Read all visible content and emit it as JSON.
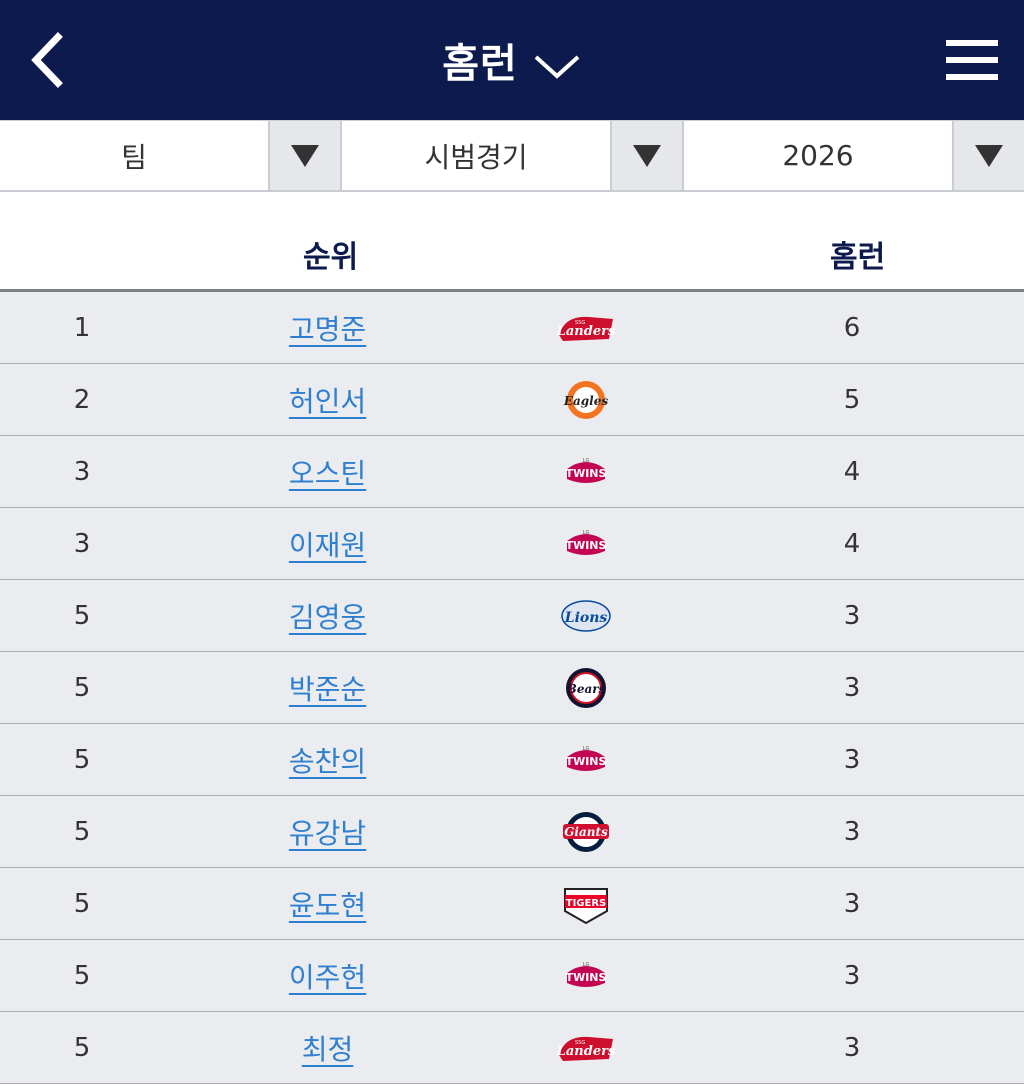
{
  "header": {
    "title": "홈런",
    "back_icon": "chevron-left-icon",
    "dropdown_icon": "chevron-down-icon",
    "menu_icon": "hamburger-menu-icon"
  },
  "filters": [
    {
      "value": "팀"
    },
    {
      "value": "시범경기"
    },
    {
      "value": "2026"
    }
  ],
  "table": {
    "columns": {
      "rank": "순위",
      "homeruns": "홈런"
    },
    "rows": [
      {
        "rank": "1",
        "name": "고명준",
        "team": "landers",
        "hr": "6"
      },
      {
        "rank": "2",
        "name": "허인서",
        "team": "eagles",
        "hr": "5"
      },
      {
        "rank": "3",
        "name": "오스틴",
        "team": "twins",
        "hr": "4"
      },
      {
        "rank": "3",
        "name": "이재원",
        "team": "twins",
        "hr": "4"
      },
      {
        "rank": "5",
        "name": "김영웅",
        "team": "lions",
        "hr": "3"
      },
      {
        "rank": "5",
        "name": "박준순",
        "team": "bears",
        "hr": "3"
      },
      {
        "rank": "5",
        "name": "송찬의",
        "team": "twins",
        "hr": "3"
      },
      {
        "rank": "5",
        "name": "유강남",
        "team": "giants",
        "hr": "3"
      },
      {
        "rank": "5",
        "name": "윤도현",
        "team": "tigers",
        "hr": "3"
      },
      {
        "rank": "5",
        "name": "이주헌",
        "team": "twins",
        "hr": "3"
      },
      {
        "rank": "5",
        "name": "최정",
        "team": "landers",
        "hr": "3"
      }
    ]
  },
  "logos": {
    "landers": {
      "label": "Landers",
      "top": "SSG"
    },
    "eagles": {
      "label": "Eagles"
    },
    "twins": {
      "label": "TWINS",
      "top": "LG"
    },
    "lions": {
      "label": "Lions"
    },
    "bears": {
      "label": "Bears"
    },
    "giants": {
      "label": "Giants"
    },
    "tigers": {
      "label": "TIGERS"
    }
  },
  "colors": {
    "header_bg": "#0c1a4d",
    "link": "#2f7fd0",
    "row_bg": "#ebecef",
    "landers": "#ce0e2d",
    "eagles": "#f37321",
    "twins": "#c30452",
    "lions": "#074ca1",
    "bears": "#131230",
    "giants": "#041e42",
    "tigers": "#ea0029"
  }
}
